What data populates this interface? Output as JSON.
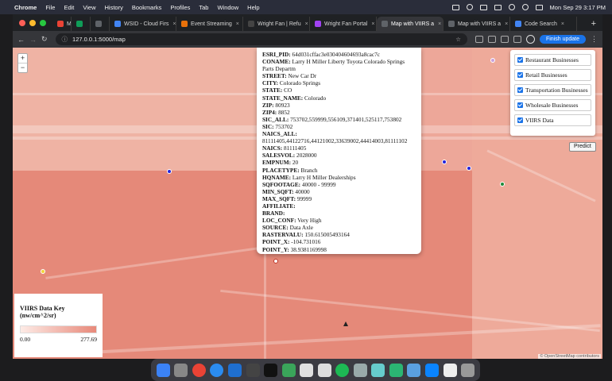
{
  "menubar": {
    "app_name": "Chrome",
    "items": [
      "File",
      "Edit",
      "View",
      "History",
      "Bookmarks",
      "Profiles",
      "Tab",
      "Window",
      "Help"
    ],
    "clock": "Mon Sep 29  3:17 PM"
  },
  "tabs": [
    {
      "label": "M",
      "fav": "#ea4335"
    },
    {
      "label": "",
      "fav": "#0f9d58"
    },
    {
      "label": "",
      "fav": "#5f6368"
    },
    {
      "label": "WSID - Cloud Firs",
      "fav": "#4285f4"
    },
    {
      "label": "Event Streaming",
      "fav": "#e8710a"
    },
    {
      "label": "Wright Fan | Refu",
      "fav": "#444"
    },
    {
      "label": "Wright Fan Portal",
      "fav": "#a142f4"
    },
    {
      "label": "Map with VIIRS a",
      "fav": "#5f6368",
      "active": true
    },
    {
      "label": "Map with VIIRS a",
      "fav": "#5f6368"
    },
    {
      "label": "Code Search",
      "fav": "#4285f4"
    }
  ],
  "toolbar": {
    "url": "127.0.0.1:5000/map",
    "finish_update": "Finish update"
  },
  "map": {
    "zoom_in": "+",
    "zoom_out": "−",
    "attribution": "© OpenStreetMap contributors"
  },
  "popup": {
    "rows": [
      {
        "k": "ESRI_PID:",
        "v": " 64d031cffac3e030404604693a8cac7c"
      },
      {
        "k": "CONAME:",
        "v": " Larry H Miller Liberty Toyota Colorado Springs Parts Departm"
      },
      {
        "k": "STREET:",
        "v": " New Car Dr"
      },
      {
        "k": "CITY:",
        "v": " Colorado Springs"
      },
      {
        "k": "STATE:",
        "v": " CO"
      },
      {
        "k": "STATE_NAME:",
        "v": " Colorado"
      },
      {
        "k": "ZIP:",
        "v": " 80923"
      },
      {
        "k": "ZIP4:",
        "v": " 8852"
      },
      {
        "k": "SIC_ALL:",
        "v": " 753702,559999,556109,371401,525117,753802"
      },
      {
        "k": "SIC:",
        "v": " 753702"
      },
      {
        "k": "NAICS_ALL:",
        "v": " 81111405,44122716,44121002,33639002,44414003,81111102"
      },
      {
        "k": "NAICS:",
        "v": " 81111405"
      },
      {
        "k": "SALESVOL:",
        "v": " 2028000"
      },
      {
        "k": "EMPNUM:",
        "v": " 20"
      },
      {
        "k": "PLACETYPE:",
        "v": " Branch"
      },
      {
        "k": "HQNAME:",
        "v": " Larry H Miller Dealerships"
      },
      {
        "k": "SQFOOTAGE:",
        "v": " 40000 - 99999"
      },
      {
        "k": "MIN_SQFT:",
        "v": " 40000"
      },
      {
        "k": "MAX_SQFT:",
        "v": " 99999"
      },
      {
        "k": "AFFILIATE:",
        "v": ""
      },
      {
        "k": "BRAND:",
        "v": ""
      },
      {
        "k": "LOC_CONF:",
        "v": " Very High"
      },
      {
        "k": "SOURCE:",
        "v": " Data Axle"
      },
      {
        "k": "RASTERVALU:",
        "v": " 150.615005493164"
      },
      {
        "k": "POINT_X:",
        "v": " -104.731016"
      },
      {
        "k": "POINT_Y:",
        "v": " 38.9381169998"
      }
    ]
  },
  "layers": {
    "items": [
      {
        "label": "Restaurant Businesses",
        "checked": true
      },
      {
        "label": "Retail Businesses",
        "checked": true
      },
      {
        "label": "Transportation Businesses",
        "checked": true
      },
      {
        "label": "Wholesale Businesses",
        "checked": true
      },
      {
        "label": "VIIRS Data",
        "checked": true
      }
    ]
  },
  "predict_button": "Predict",
  "legend": {
    "title": "VIIRS Data Key (nw/cm^2/sr)",
    "min": "0.00",
    "max": "277.69",
    "color_low": "#fdebe6",
    "color_high": "#e8897a"
  },
  "colors": {
    "map_base": "#ec9a8a",
    "accent": "#1a73e8",
    "marker_blue": "#2222dd",
    "marker_green": "#1e8a3a",
    "marker_yellow": "#f2d43a",
    "marker_red": "#c0392b"
  }
}
